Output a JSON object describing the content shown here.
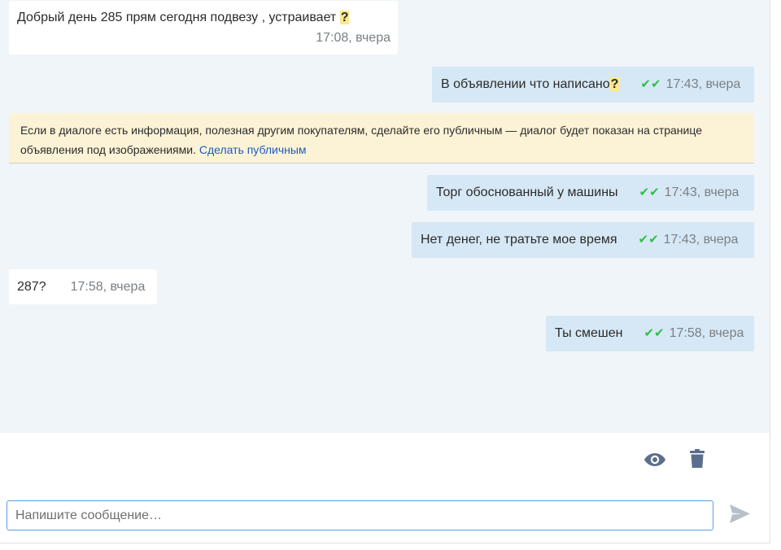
{
  "messages": [
    {
      "id": "m1",
      "direction": "incoming",
      "text": "Добрый день 285 прям сегодня подвезу , устраивает ",
      "suffix": "?",
      "time": "17:08, вчера"
    },
    {
      "id": "m2",
      "direction": "outgoing",
      "text": "В объявлении что написано",
      "suffix": "?",
      "check": "✔✔",
      "time": "17:43, вчера"
    },
    {
      "id": "m3",
      "direction": "outgoing",
      "text": "Торг обоснованный у машины",
      "check": "✔✔",
      "time": "17:43, вчера"
    },
    {
      "id": "m4",
      "direction": "outgoing",
      "text": "Нет денег, не тратьте мое время",
      "check": "✔✔",
      "time": "17:43, вчера"
    },
    {
      "id": "m5",
      "direction": "incoming",
      "text": "287?",
      "time": "17:58, вчера"
    },
    {
      "id": "m6",
      "direction": "outgoing",
      "text": "Ты смешен",
      "check": "✔✔",
      "time": "17:58, вчера"
    }
  ],
  "notice": {
    "text": "Если в диалоге есть информация, полезная другим покупателям, сделайте его публичным — диалог будет показан на странице объявления под изображениями.",
    "link": "Сделать публичным"
  },
  "actions": {
    "view_icon": "eye-icon",
    "delete_icon": "trash-icon"
  },
  "composer": {
    "placeholder": "Напишите сообщение…",
    "value": "",
    "send_icon": "send-icon"
  },
  "colors": {
    "chat_bg": "#f0f5f9",
    "outgoing_bg": "#d6e8f5",
    "incoming_bg": "#ffffff",
    "notice_bg": "#fcf3d7",
    "link": "#1d5bbf",
    "read_check": "#2fbf4a",
    "icon": "#5b6f8c"
  }
}
